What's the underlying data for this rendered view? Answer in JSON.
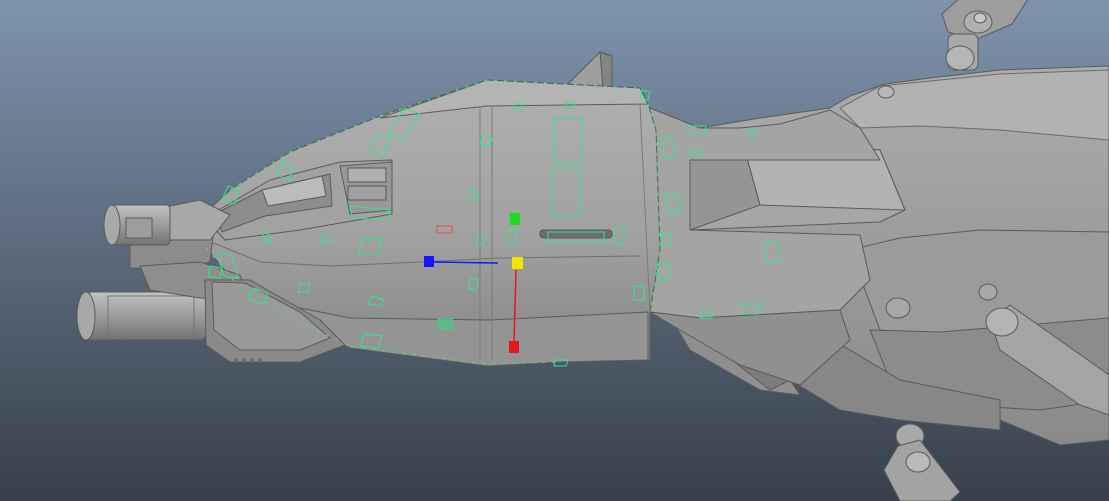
{
  "viewport": {
    "kind": "3d-modeling-viewport",
    "background": {
      "top": "#7f93ad",
      "bottom": "#37404a"
    },
    "model": {
      "base_color": "#9a9a9a",
      "light_color": "#b3b3b3",
      "dark_color": "#6b6b6b",
      "edge_color": "#575757"
    },
    "uv_shell_color": "#30e888",
    "manipulator": {
      "x_axis_color": "#e01a1a",
      "y_axis_color": "#15e015",
      "z_axis_color": "#1414ff",
      "center_color": "#f2e600"
    }
  }
}
